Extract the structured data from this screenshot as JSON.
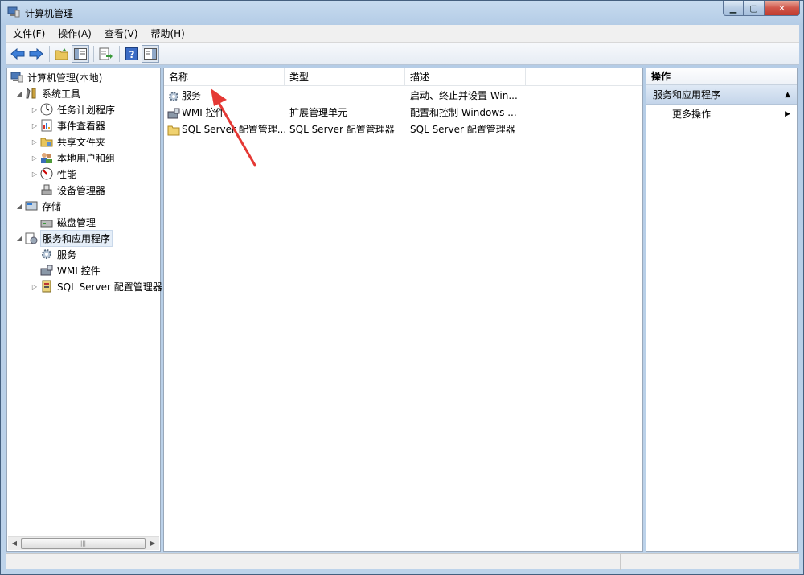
{
  "window": {
    "title": "计算机管理",
    "icon": "computer-management-icon",
    "controls": {
      "minimize": "minimize-icon",
      "maximize": "maximize-icon",
      "close": "close-icon"
    }
  },
  "menu": [
    {
      "label": "文件(F)"
    },
    {
      "label": "操作(A)"
    },
    {
      "label": "查看(V)"
    },
    {
      "label": "帮助(H)"
    }
  ],
  "toolbar": {
    "buttons": [
      "back-icon",
      "forward-icon",
      "up-folder-icon",
      "show-hide-tree-icon",
      "export-list-icon",
      "help-icon",
      "show-hide-action-pane-icon"
    ]
  },
  "tree": {
    "root": "计算机管理(本地)",
    "system_tools": "系统工具",
    "task_scheduler": "任务计划程序",
    "event_viewer": "事件查看器",
    "shared_folders": "共享文件夹",
    "local_users": "本地用户和组",
    "performance": "性能",
    "device_manager": "设备管理器",
    "storage": "存储",
    "disk_management": "磁盘管理",
    "services_apps": "服务和应用程序",
    "services": "服务",
    "wmi": "WMI 控件",
    "sql_config": "SQL Server 配置管理器"
  },
  "list": {
    "columns": [
      "名称",
      "类型",
      "描述"
    ],
    "rows": [
      {
        "name": "服务",
        "type": "",
        "desc": "启动、终止并设置 Win..."
      },
      {
        "name": "WMI 控件",
        "type": "扩展管理单元",
        "desc": "配置和控制 Windows ..."
      },
      {
        "name": "SQL Server 配置管理...",
        "type": "SQL Server 配置管理器",
        "desc": "SQL Server 配置管理器"
      }
    ]
  },
  "actions": {
    "title": "操作",
    "group": "服务和应用程序",
    "more": "更多操作"
  },
  "annotation": {
    "color": "#e53935"
  }
}
